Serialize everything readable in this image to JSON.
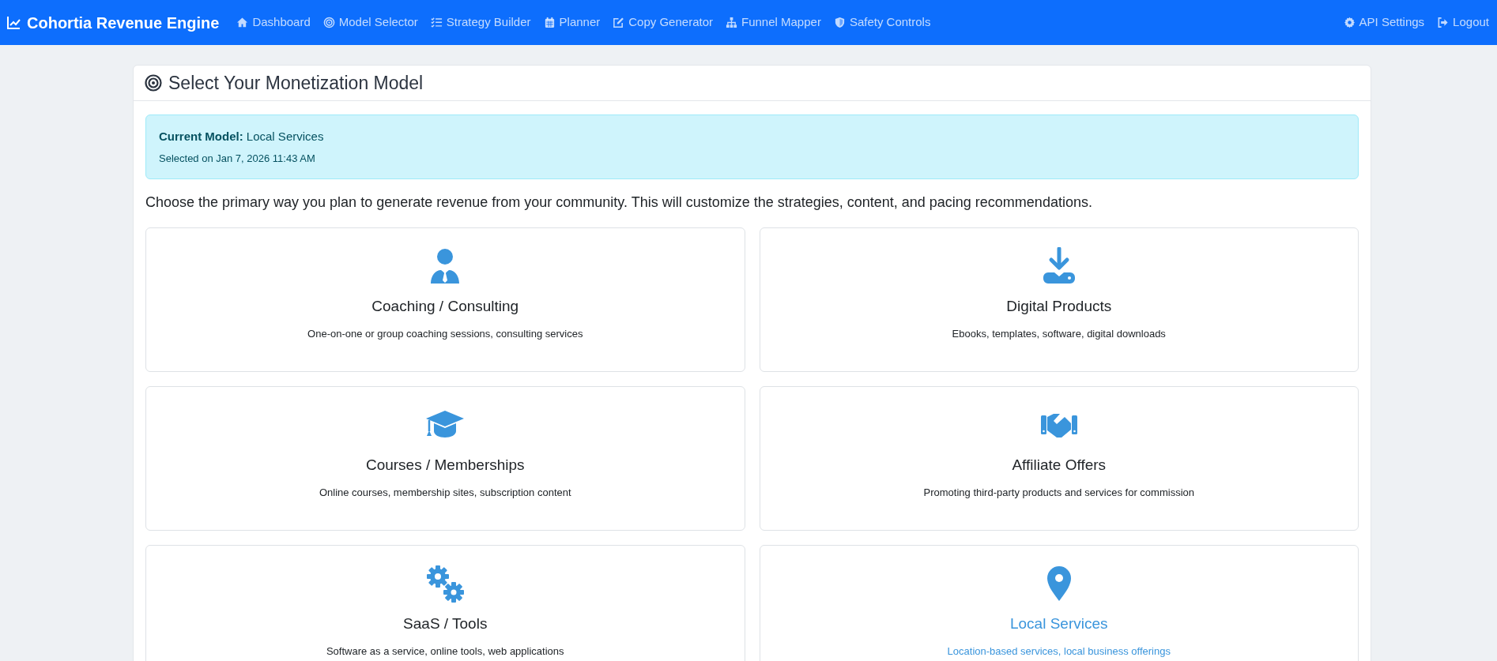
{
  "navbar": {
    "brand": "Cohortia Revenue Engine",
    "links": [
      {
        "label": "Dashboard",
        "kind": "home"
      },
      {
        "label": "Model Selector",
        "kind": "target"
      },
      {
        "label": "Strategy Builder",
        "kind": "list"
      },
      {
        "label": "Planner",
        "kind": "calendar"
      },
      {
        "label": "Copy Generator",
        "kind": "edit"
      },
      {
        "label": "Funnel Mapper",
        "kind": "sitemap"
      },
      {
        "label": "Safety Controls",
        "kind": "shield"
      }
    ],
    "right_links": [
      {
        "label": "API Settings",
        "kind": "gear"
      },
      {
        "label": "Logout",
        "kind": "logout"
      }
    ]
  },
  "page": {
    "title": "Select Your Monetization Model",
    "alert": {
      "label": "Current Model:",
      "value": "Local Services",
      "selected_on": "Selected on Jan 7, 2026 11:43 AM"
    },
    "description": "Choose the primary way you plan to generate revenue from your community. This will customize the strategies, content, and pacing recommendations.",
    "models": [
      {
        "title": "Coaching / Consulting",
        "description": "One-on-one or group coaching sessions, consulting services",
        "kind": "person",
        "selected": false
      },
      {
        "title": "Digital Products",
        "description": "Ebooks, templates, software, digital downloads",
        "kind": "download",
        "selected": false
      },
      {
        "title": "Courses / Memberships",
        "description": "Online courses, membership sites, subscription content",
        "kind": "cap",
        "selected": false
      },
      {
        "title": "Affiliate Offers",
        "description": "Promoting third-party products and services for commission",
        "kind": "handshake",
        "selected": false
      },
      {
        "title": "SaaS / Tools",
        "description": "Software as a service, online tools, web applications",
        "kind": "gears",
        "selected": false
      },
      {
        "title": "Local Services",
        "description": "Location-based services, local business offerings",
        "kind": "pin",
        "selected": true
      }
    ]
  }
}
